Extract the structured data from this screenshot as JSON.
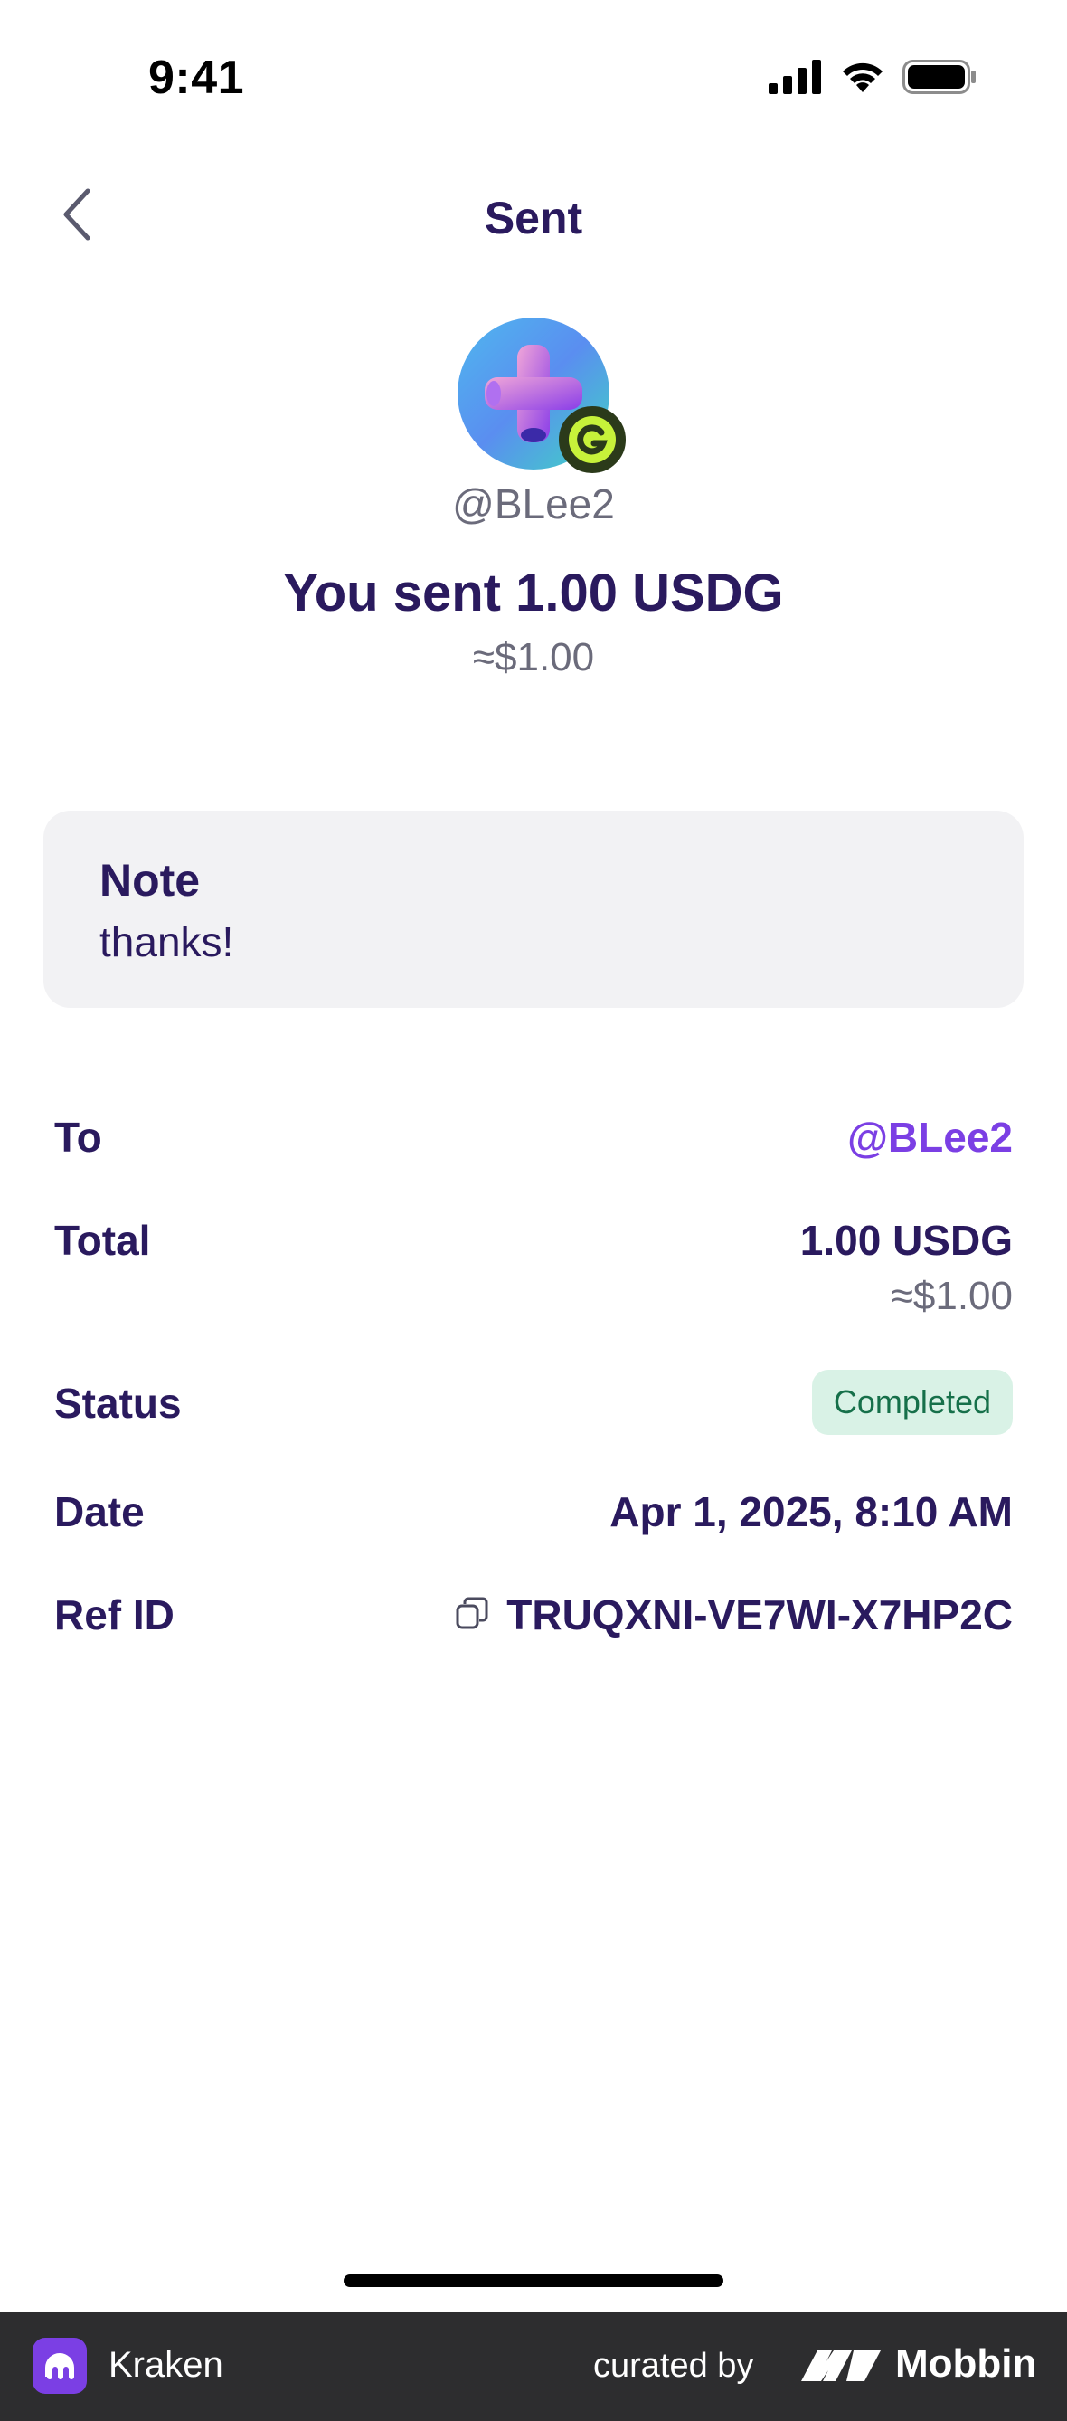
{
  "status_bar": {
    "time": "9:41"
  },
  "nav": {
    "title": "Sent"
  },
  "recipient": {
    "handle": "@BLee2"
  },
  "summary": {
    "headline": "You sent 1.00 USDG",
    "fiat_equivalent": "≈$1.00"
  },
  "note": {
    "label": "Note",
    "text": "thanks!"
  },
  "details": {
    "to": {
      "label": "To",
      "value": "@BLee2"
    },
    "total": {
      "label": "Total",
      "value": "1.00 USDG",
      "sub_value": "≈$1.00"
    },
    "status": {
      "label": "Status",
      "value": "Completed"
    },
    "date": {
      "label": "Date",
      "value": "Apr 1, 2025, 8:10 AM"
    },
    "ref_id": {
      "label": "Ref ID",
      "value": "TRUQXNI-VE7WI-X7HP2C"
    }
  },
  "footer": {
    "app_name": "Kraken",
    "curated_by": "curated by",
    "brand": "Mobbin"
  },
  "colors": {
    "primary_text": "#2a1a5e",
    "link": "#7b3fe4",
    "success_bg": "#d9f2e6",
    "success_text": "#16704a"
  },
  "icons": [
    "back-chevron-icon",
    "signal-icon",
    "wifi-icon",
    "battery-icon",
    "copy-icon",
    "kraken-logo-icon",
    "mobbin-logo-icon"
  ]
}
